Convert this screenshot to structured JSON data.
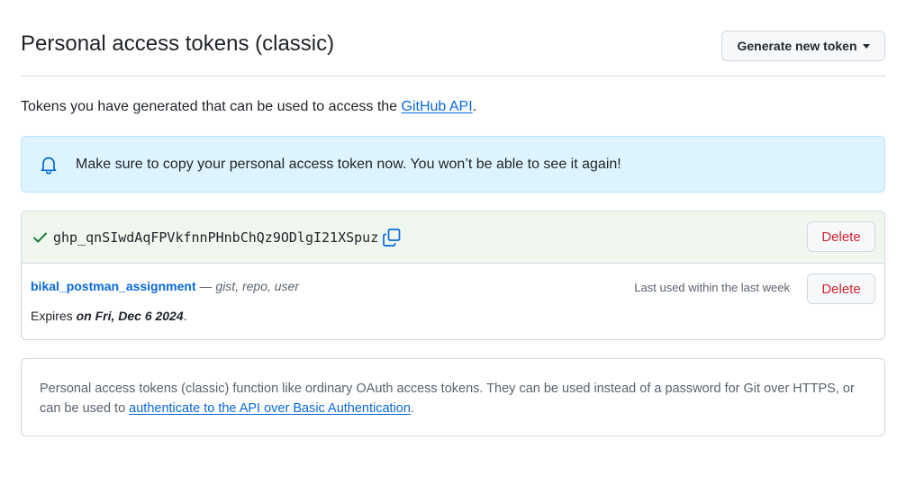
{
  "header": {
    "title": "Personal access tokens (classic)",
    "generate_button": "Generate new token"
  },
  "intro": {
    "text_before": "Tokens you have generated that can be used to access the ",
    "link": "GitHub API",
    "text_after": "."
  },
  "flash": {
    "icon": "bell-icon",
    "message": "Make sure to copy your personal access token now. You won’t be able to see it again!"
  },
  "new_token": {
    "value": "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",
    "delete_label": "Delete"
  },
  "token": {
    "name": "bikal_postman_assignment",
    "separator": " — ",
    "scopes": "gist, repo, user",
    "last_used": "Last used within the last week",
    "delete_label": "Delete",
    "expires_prefix": "Expires ",
    "expires_date": "on Fri, Dec 6 2024",
    "expires_suffix": "."
  },
  "note": {
    "text_before": "Personal access tokens (classic) function like ordinary OAuth access tokens. They can be used instead of a password for Git over HTTPS, or can be used to ",
    "link": "authenticate to the API over Basic Authentication",
    "text_after": "."
  },
  "colors": {
    "accent": "#0969da",
    "danger": "#d1242f",
    "success": "#1a7f37",
    "flash_bg": "#ddf4ff",
    "token_bg": "#eff7ef"
  }
}
